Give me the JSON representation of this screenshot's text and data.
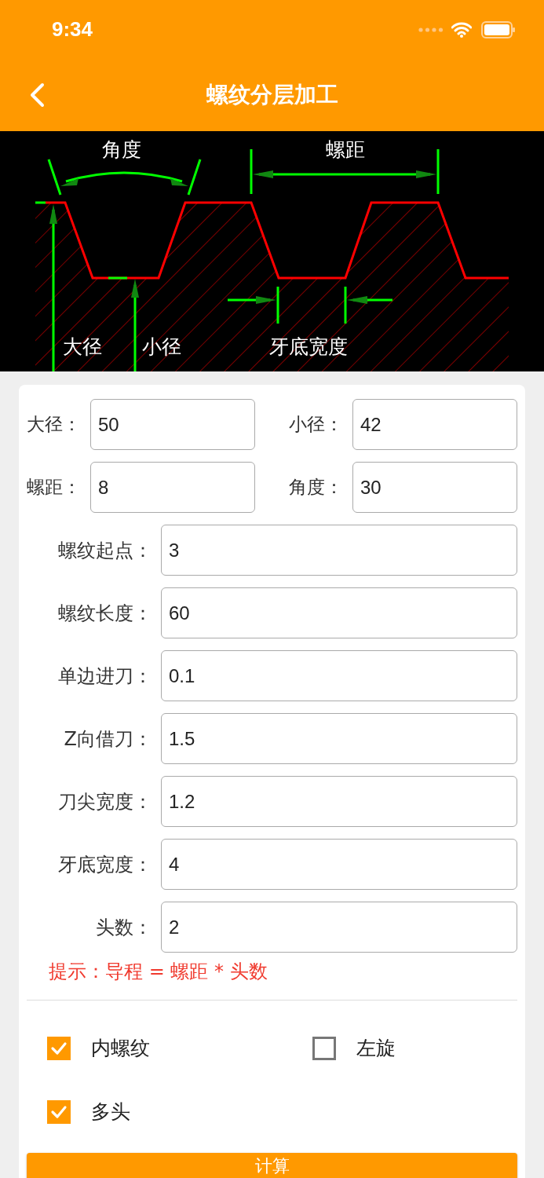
{
  "status_bar": {
    "time": "9:34"
  },
  "nav": {
    "title": "螺纹分层加工"
  },
  "diagram": {
    "labels": [
      "角度",
      "螺距",
      "大径",
      "小径",
      "牙底宽度"
    ]
  },
  "form": {
    "rows": [
      {
        "kind": "pair",
        "fields": [
          {
            "label": "大径：",
            "value": "50"
          },
          {
            "label": "小径：",
            "value": "42"
          }
        ]
      },
      {
        "kind": "pair",
        "fields": [
          {
            "label": "螺距：",
            "value": "8"
          },
          {
            "label": "角度：",
            "value": "30"
          }
        ]
      },
      {
        "kind": "full",
        "fields": [
          {
            "label": "螺纹起点：",
            "value": "3"
          }
        ]
      },
      {
        "kind": "full",
        "fields": [
          {
            "label": "螺纹长度：",
            "value": "60"
          }
        ]
      },
      {
        "kind": "full",
        "fields": [
          {
            "label": "单边进刀：",
            "value": "0.1"
          }
        ]
      },
      {
        "kind": "full",
        "fields": [
          {
            "label": "Z向借刀：",
            "value": "1.5"
          }
        ]
      },
      {
        "kind": "full",
        "fields": [
          {
            "label": "刀尖宽度：",
            "value": "1.2"
          }
        ]
      },
      {
        "kind": "full",
        "fields": [
          {
            "label": "牙底宽度：",
            "value": "4"
          }
        ]
      },
      {
        "kind": "full",
        "fields": [
          {
            "label": "头数：",
            "value": "2"
          }
        ]
      }
    ],
    "hint": "提示：导程 = 螺距 * 头数",
    "checkboxes": [
      {
        "label": "内螺纹",
        "checked": true
      },
      {
        "label": "左旋",
        "checked": false
      },
      {
        "label": "多头",
        "checked": true
      }
    ],
    "button": "计算"
  }
}
